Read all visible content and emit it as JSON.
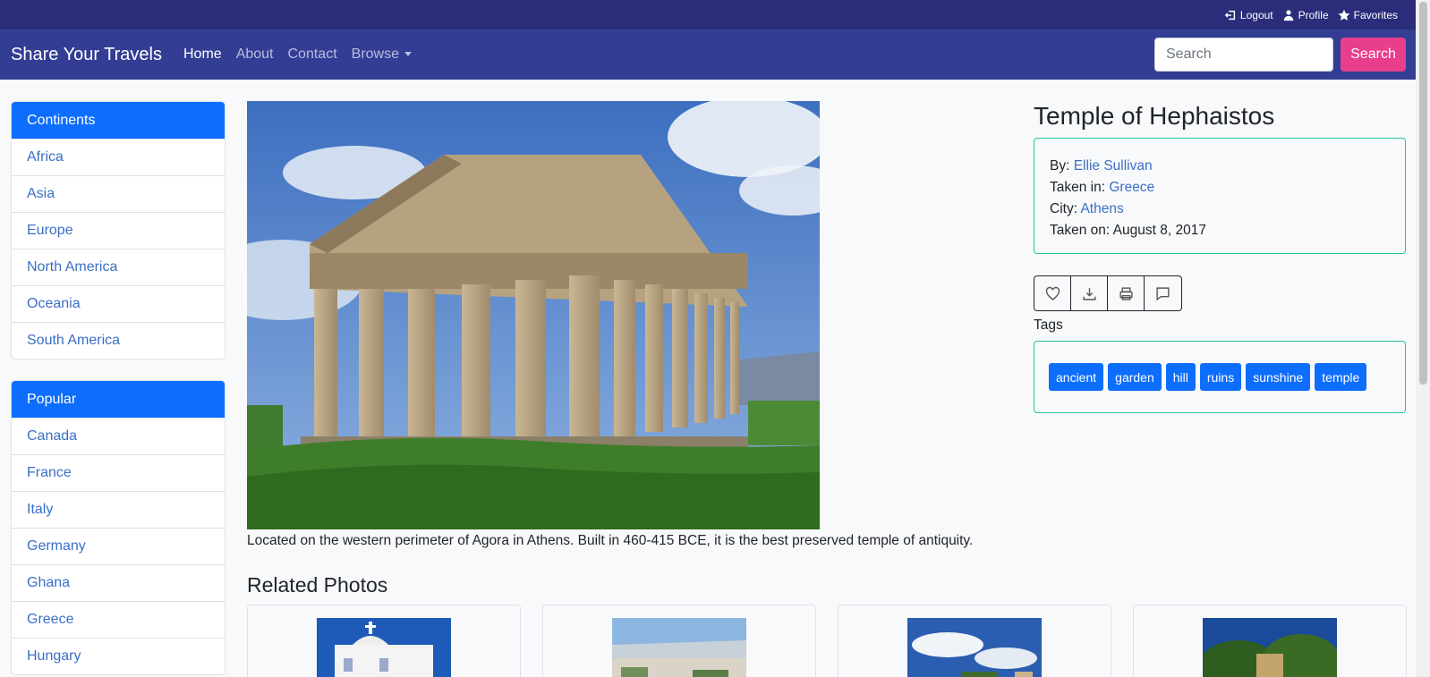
{
  "topbar": {
    "logout": "Logout",
    "profile": "Profile",
    "favorites": "Favorites"
  },
  "navbar": {
    "brand": "Share Your Travels",
    "links": [
      "Home",
      "About",
      "Contact",
      "Browse"
    ],
    "search_placeholder": "Search",
    "search_button": "Search"
  },
  "sidebar": {
    "continents": {
      "title": "Continents",
      "items": [
        "Africa",
        "Asia",
        "Europe",
        "North America",
        "Oceania",
        "South America"
      ]
    },
    "popular": {
      "title": "Popular",
      "items": [
        "Canada",
        "France",
        "Italy",
        "Germany",
        "Ghana",
        "Greece",
        "Hungary"
      ]
    }
  },
  "photo": {
    "title": "Temple of Hephaistos",
    "caption": "Located on the western perimeter of Agora in Athens. Built in 460-415 BCE, it is the best preserved temple of antiquity.",
    "by_label": "By:",
    "by_value": "Ellie Sullivan",
    "country_label": "Taken in:",
    "country_value": "Greece",
    "city_label": "City:",
    "city_value": "Athens",
    "date_label": "Taken on:",
    "date_value": "August 8, 2017"
  },
  "actions": [
    "heart-icon",
    "download-icon",
    "printer-icon",
    "comment-icon"
  ],
  "tags": {
    "label": "Tags",
    "items": [
      "ancient",
      "garden",
      "hill",
      "ruins",
      "sunshine",
      "temple"
    ]
  },
  "related": {
    "title": "Related Photos"
  },
  "colors": {
    "topbar": "#2b2d7a",
    "navbar": "#333d94",
    "accent_pink": "#e83e8c",
    "primary": "#0d6efd",
    "teal_border": "#20c997",
    "link": "#3b6fc6"
  }
}
